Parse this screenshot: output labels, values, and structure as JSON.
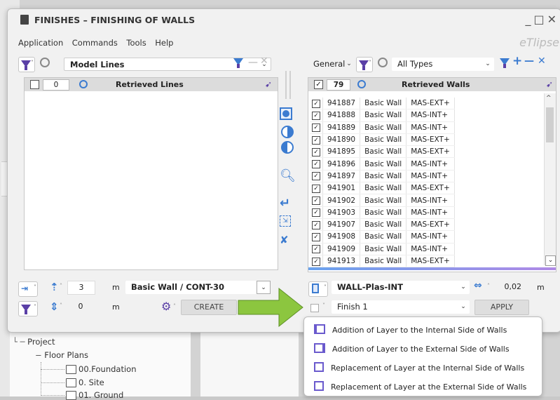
{
  "app": {
    "title": "FINISHES – FINISHING OF WALLS",
    "brand": "eTlipse",
    "menu": [
      "Application",
      "Commands",
      "Tools",
      "Help"
    ],
    "window_controls": [
      "_",
      "□",
      "✕"
    ]
  },
  "left": {
    "filter_combo": "Model Lines",
    "header": {
      "count": "0",
      "title": "Retrieved Lines"
    },
    "rows": []
  },
  "right": {
    "category_combo": "General",
    "types_combo": "All Types",
    "header": {
      "count": "79",
      "title": "Retrieved Walls"
    },
    "rows": [
      {
        "id": "941887",
        "type": "Basic Wall",
        "name": "MAS-EXT+",
        "checked": true
      },
      {
        "id": "941888",
        "type": "Basic Wall",
        "name": "MAS-INT+",
        "checked": true
      },
      {
        "id": "941889",
        "type": "Basic Wall",
        "name": "MAS-INT+",
        "checked": true
      },
      {
        "id": "941890",
        "type": "Basic Wall",
        "name": "MAS-EXT+",
        "checked": true
      },
      {
        "id": "941895",
        "type": "Basic Wall",
        "name": "MAS-EXT+",
        "checked": true
      },
      {
        "id": "941896",
        "type": "Basic Wall",
        "name": "MAS-INT+",
        "checked": true
      },
      {
        "id": "941897",
        "type": "Basic Wall",
        "name": "MAS-INT+",
        "checked": true
      },
      {
        "id": "941901",
        "type": "Basic Wall",
        "name": "MAS-EXT+",
        "checked": true
      },
      {
        "id": "941902",
        "type": "Basic Wall",
        "name": "MAS-INT+",
        "checked": true
      },
      {
        "id": "941903",
        "type": "Basic Wall",
        "name": "MAS-INT+",
        "checked": true
      },
      {
        "id": "941907",
        "type": "Basic Wall",
        "name": "MAS-EXT+",
        "checked": true
      },
      {
        "id": "941908",
        "type": "Basic Wall",
        "name": "MAS-INT+",
        "checked": true
      },
      {
        "id": "941909",
        "type": "Basic Wall",
        "name": "MAS-INT+",
        "checked": true
      },
      {
        "id": "941913",
        "type": "Basic Wall",
        "name": "MAS-EXT+",
        "checked": true
      }
    ]
  },
  "bottom_left": {
    "height_value": "3",
    "height_unit": "m",
    "wall_type": "Basic Wall / CONT-30",
    "offset_value": "0",
    "offset_unit": "m",
    "create_label": "CREATE"
  },
  "bottom_right": {
    "layer_combo": "WALL-Plas-INT",
    "thickness_value": "0,02",
    "thickness_unit": "m",
    "finish_combo": "Finish 1",
    "apply_label": "APPLY"
  },
  "dropdown_options": [
    "Addition of Layer to the Internal Side of Walls",
    "Addition of Layer to the External Side of Walls",
    "Replacement of Layer at the Internal Side of Walls",
    "Replacement of Layer at the External Side of Walls"
  ],
  "tree": {
    "project": "Project",
    "floor_plans": "Floor Plans",
    "items": [
      "00.Foundation",
      "0. Site",
      "01. Ground"
    ]
  },
  "colors": {
    "accent": "#5a3fa6",
    "blue": "#3b7bd0",
    "arrow_green": "#8cc63f"
  }
}
